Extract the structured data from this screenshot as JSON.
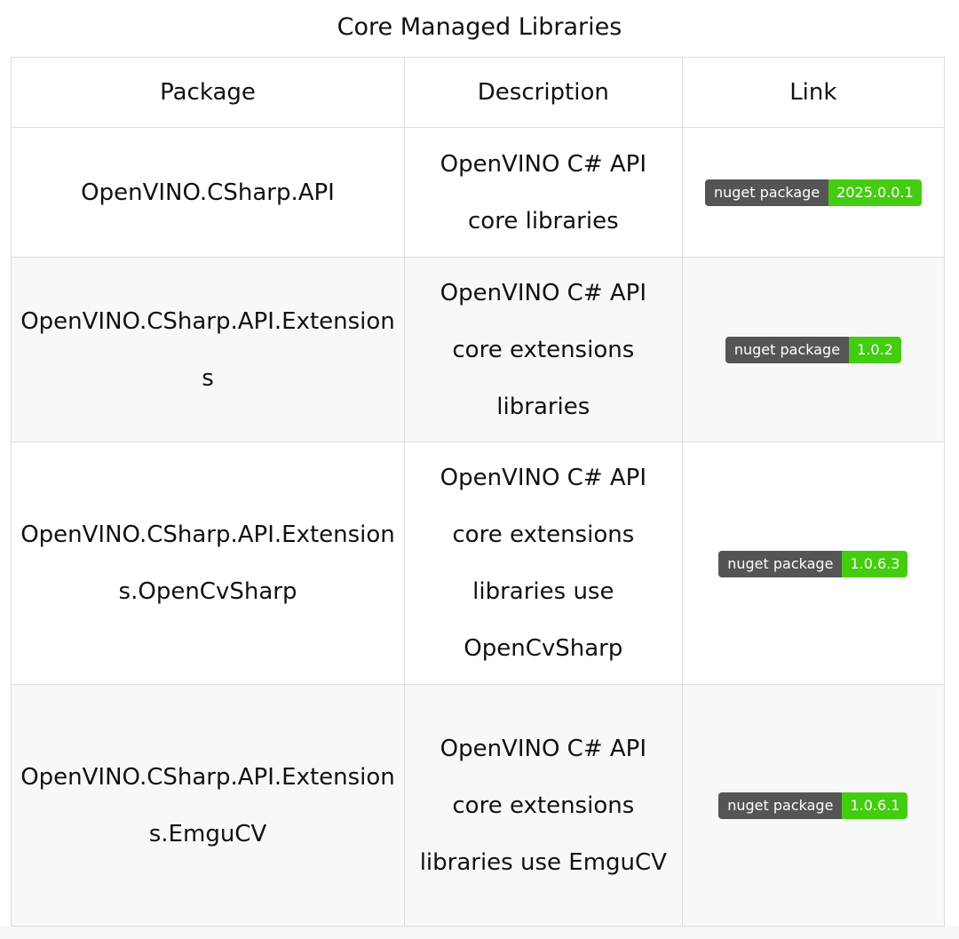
{
  "caption": "Core Managed Libraries",
  "table": {
    "headers": [
      "Package",
      "Description",
      "Link"
    ],
    "rows": [
      {
        "package": "OpenVINO.CSharp.API",
        "description": "OpenVINO C# API core libraries",
        "badge_label": "nuget package",
        "badge_version": "2025.0.0.1"
      },
      {
        "package": "OpenVINO.CSharp.API.Extensions",
        "description": "OpenVINO C# API core extensions libraries",
        "badge_label": "nuget package",
        "badge_version": "1.0.2"
      },
      {
        "package": "OpenVINO.CSharp.API.Extensions.OpenCvSharp",
        "description": "OpenVINO C# API core extensions libraries use OpenCvSharp",
        "badge_label": "nuget package",
        "badge_version": "1.0.6.3"
      },
      {
        "package": "OpenVINO.CSharp.API.Extensions.EmguCV",
        "description": "OpenVINO C# API core extensions libraries use EmguCV",
        "badge_label": "nuget package",
        "badge_version": "1.0.6.1"
      }
    ]
  },
  "colors": {
    "badge_label_bg": "#555555",
    "badge_version_bg": "#44cc11",
    "border": "#dddddd",
    "stripe": "#f8f8f8"
  }
}
